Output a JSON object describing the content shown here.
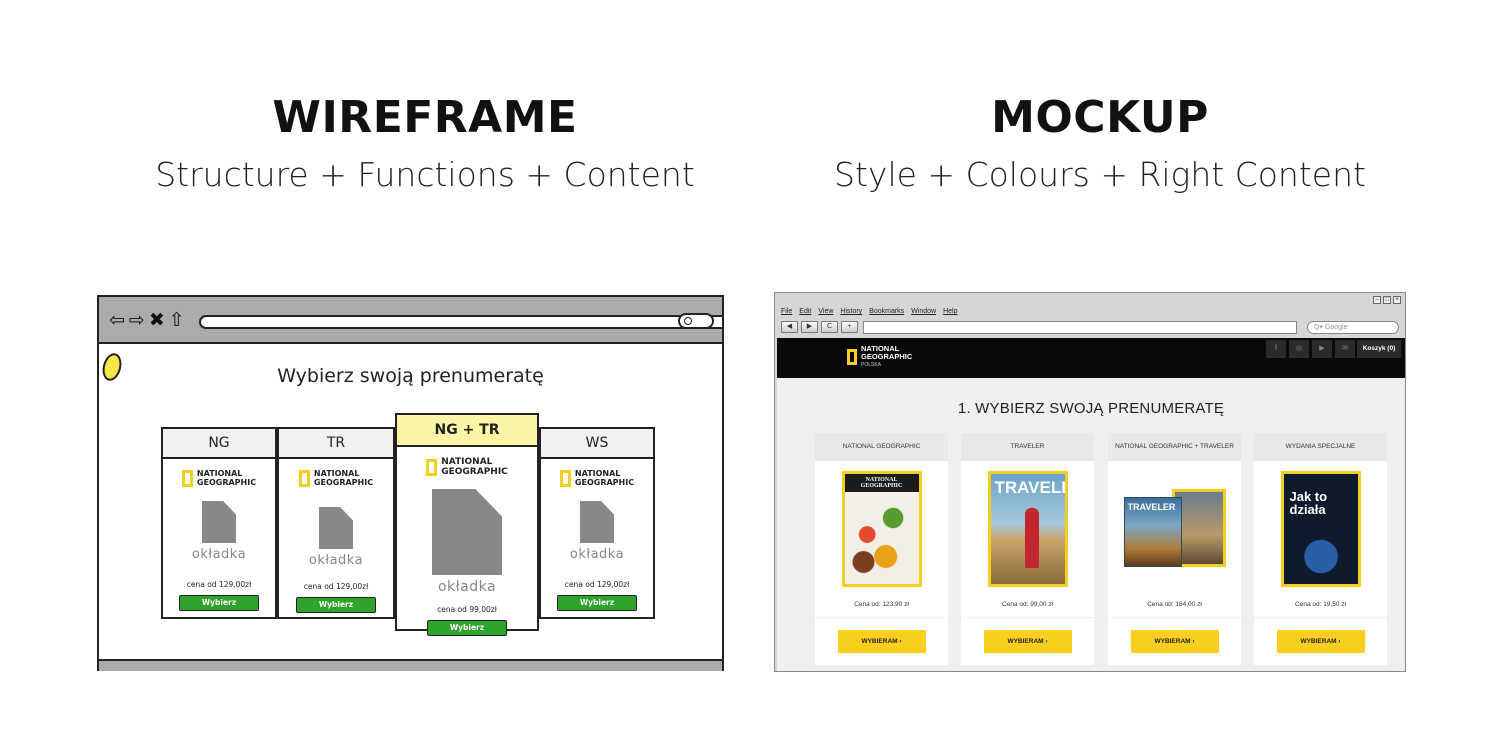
{
  "left": {
    "heading": "WIREFRAME",
    "subheading": "Structure + Functions + Content"
  },
  "right": {
    "heading": "MOCKUP",
    "subheading": "Style + Colours + Right Content"
  },
  "wireframe": {
    "nav_icons": [
      "⇦",
      "⇨",
      "✖",
      "⇧"
    ],
    "title": "Wybierz swoją prenumeratę",
    "logo_text": [
      "NATIONAL",
      "GEOGRAPHIC"
    ],
    "cards": [
      {
        "name": "NG",
        "cover": "okładka",
        "price": "cena od 129,00zł",
        "button": "Wybierz"
      },
      {
        "name": "TR",
        "cover": "okładka",
        "price": "cena od 129,00zł",
        "button": "Wybierz"
      },
      {
        "name": "NG + TR",
        "cover": "okładka",
        "price": "cena od 99,00zł",
        "button": "Wybierz"
      },
      {
        "name": "WS",
        "cover": "okładka",
        "price": "cena od 129,00zł",
        "button": "Wybierz"
      }
    ]
  },
  "mockup": {
    "menu": [
      "File",
      "Edit",
      "View",
      "History",
      "Bookmarks",
      "Window",
      "Help"
    ],
    "nav_buttons": [
      "◀",
      "▶",
      "C",
      "+"
    ],
    "search_placeholder": "Q▾ Google",
    "logo_lines": [
      "NATIONAL",
      "GEOGRAPHIC",
      "POLSKA"
    ],
    "social_icons": [
      "f",
      "◎",
      "▶",
      "✉"
    ],
    "cart": "Koszyk (0)",
    "heading": "1. WYBIERZ SWOJĄ PRENUMERATĘ",
    "cards": [
      {
        "name": "NATIONAL GEOGRAPHIC",
        "price": "Cena od: 123,90 zł",
        "button": "WYBIERAM  ›",
        "cover_text": "NATIONAL GEOGRAPHIC"
      },
      {
        "name": "TRAVELER",
        "price": "Cena od: 99,00 zł",
        "button": "WYBIERAM  ›",
        "cover_text": "TRAVELER"
      },
      {
        "name": "NATIONAL GEOGRAPHIC + TRAVELER",
        "price": "Cena od: 184,00 zł",
        "button": "WYBIERAM  ›",
        "cover_text": "TRAVELER"
      },
      {
        "name": "WYDANIA SPECJALNE",
        "price": "Cena od: 19,50 zł",
        "button": "WYBIERAM  ›",
        "cover_text": "Jak to działa"
      }
    ],
    "colors": {
      "accent": "#f9cf1f",
      "topbar": "#0a0a0a",
      "background": "#efefef"
    }
  }
}
